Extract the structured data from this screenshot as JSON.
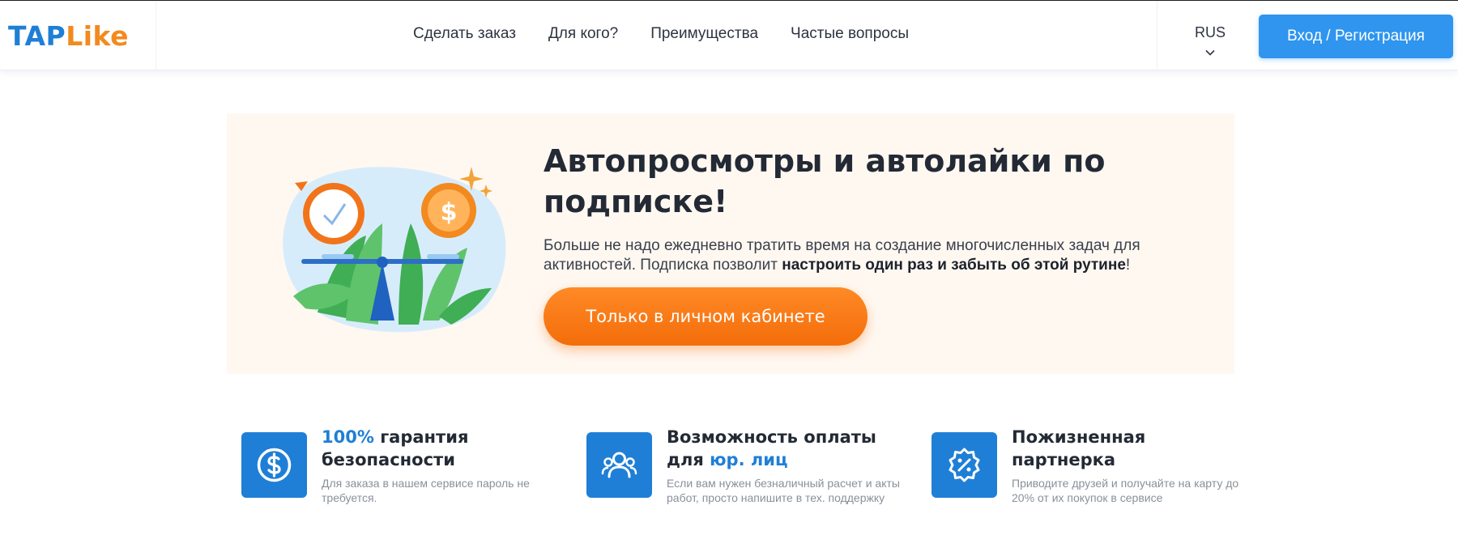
{
  "brand": {
    "tap": "TAP",
    "like": "Like"
  },
  "nav": {
    "items": [
      "Сделать заказ",
      "Для кого?",
      "Преимущества",
      "Частые вопросы"
    ]
  },
  "lang": {
    "label": "RUS",
    "icon": "chevron-down-icon"
  },
  "header": {
    "login_label": "Вход / Регистрация"
  },
  "hero": {
    "title": "Автопросмотры и автолайки по подписке!",
    "text_plain": "Больше не надо ежедневно тратить время на создание многочисленных задач для активностей. Подписка позволит ",
    "text_bold": "настроить один раз и забыть об этой рутине",
    "text_end": "!",
    "cta_label": "Только в личном кабинете",
    "illustration": "clock-and-coin-scales-illustration"
  },
  "features": [
    {
      "icon": "dollar-coin-icon",
      "title_hl": "100%",
      "title_rest": " гарантия безопасности",
      "desc": "Для заказа в нашем сервисе пароль не требуется."
    },
    {
      "icon": "users-group-icon",
      "title_rest": "Возможность оплаты для ",
      "title_hl": "юр. лиц",
      "desc": "Если вам нужен безналичный расчет и акты работ, просто напишите в тех. поддержку"
    },
    {
      "icon": "percent-badge-icon",
      "title_rest": "Пожизненная партнерка",
      "desc": "Приводите друзей и получайте на карту до 20% от их покупок в сервисе"
    }
  ],
  "colors": {
    "brand_blue": "#1f7fd6",
    "brand_orange": "#f28a1f",
    "cta_orange": "#f57a14",
    "hero_bg": "#fff8f1"
  }
}
